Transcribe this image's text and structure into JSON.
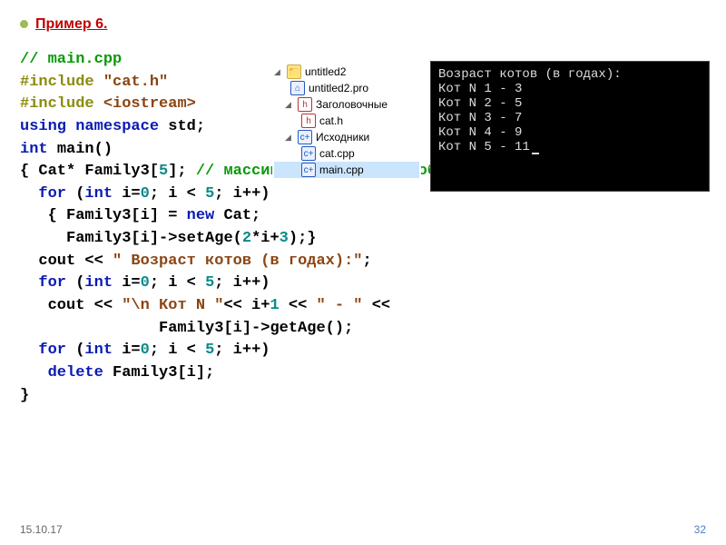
{
  "title": "Пример 6.",
  "code": {
    "l1": "// main.cpp",
    "l2a": "#include",
    "l2b": "\"cat.h\"",
    "l3a": "#include",
    "l3b": "<iostream>",
    "l4a": "using",
    "l4b": "namespace",
    "l4c": "std;",
    "l5a": "int",
    "l5b": "main()",
    "l6a": "{ Cat* Family3[",
    "l6n": "5",
    "l6b": "];",
    "l6c": "// массив указателей на объекты",
    "l7a": "for",
    "l7b": "(",
    "l7c": "int",
    "l7d": " i=",
    "l7e": "0",
    "l7f": "; i < ",
    "l7g": "5",
    "l7h": "; i++)",
    "l8a": "{ Family3[i] = ",
    "l8b": "new",
    "l8c": " Cat;",
    "l9a": "Family3[i]->setAge(",
    "l9b": "2",
    "l9c": "*i+",
    "l9d": "3",
    "l9e": ");}",
    "l10a": "cout << ",
    "l10b": "\" Возраст котов (в годах):\"",
    "l10c": ";",
    "l11a": "for",
    "l11b": "(",
    "l11c": "int",
    "l11d": " i=",
    "l11e": "0",
    "l11f": "; i < ",
    "l11g": "5",
    "l11h": "; i++)",
    "l12a": "cout << ",
    "l12b": "\"\\n Кот N \"",
    "l12c": "<< i+",
    "l12d": "1",
    "l12e": " << ",
    "l12f": "\" - \"",
    "l12g": " <<",
    "l13": "Family3[i]->getAge();",
    "l14a": "for",
    "l14b": "(",
    "l14c": "int",
    "l14d": " i=",
    "l14e": "0",
    "l14f": "; i < ",
    "l14g": "5",
    "l14h": "; i++)",
    "l15a": "delete",
    "l15b": " Family3[i];",
    "l16": "}"
  },
  "tree": {
    "root": "untitled2",
    "pro": "untitled2.pro",
    "hdr": "Заголовочные",
    "cath": "cat.h",
    "src": "Исходники",
    "catcpp": "cat.cpp",
    "maincpp": "main.cpp"
  },
  "console": {
    "l0": "Возраст котов (в годах):",
    "l1": "Кот N 1 - 3",
    "l2": "Кот N 2 - 5",
    "l3": "Кот N 3 - 7",
    "l4": "Кот N 4 - 9",
    "l5": "Кот N 5 - 11"
  },
  "footer": {
    "date": "15.10.17",
    "page": "32"
  },
  "chart_data": {
    "type": "table",
    "title": "Возраст котов (в годах)",
    "categories": [
      "Кот N 1",
      "Кот N 2",
      "Кот N 3",
      "Кот N 4",
      "Кот N 5"
    ],
    "values": [
      3,
      5,
      7,
      9,
      11
    ]
  }
}
